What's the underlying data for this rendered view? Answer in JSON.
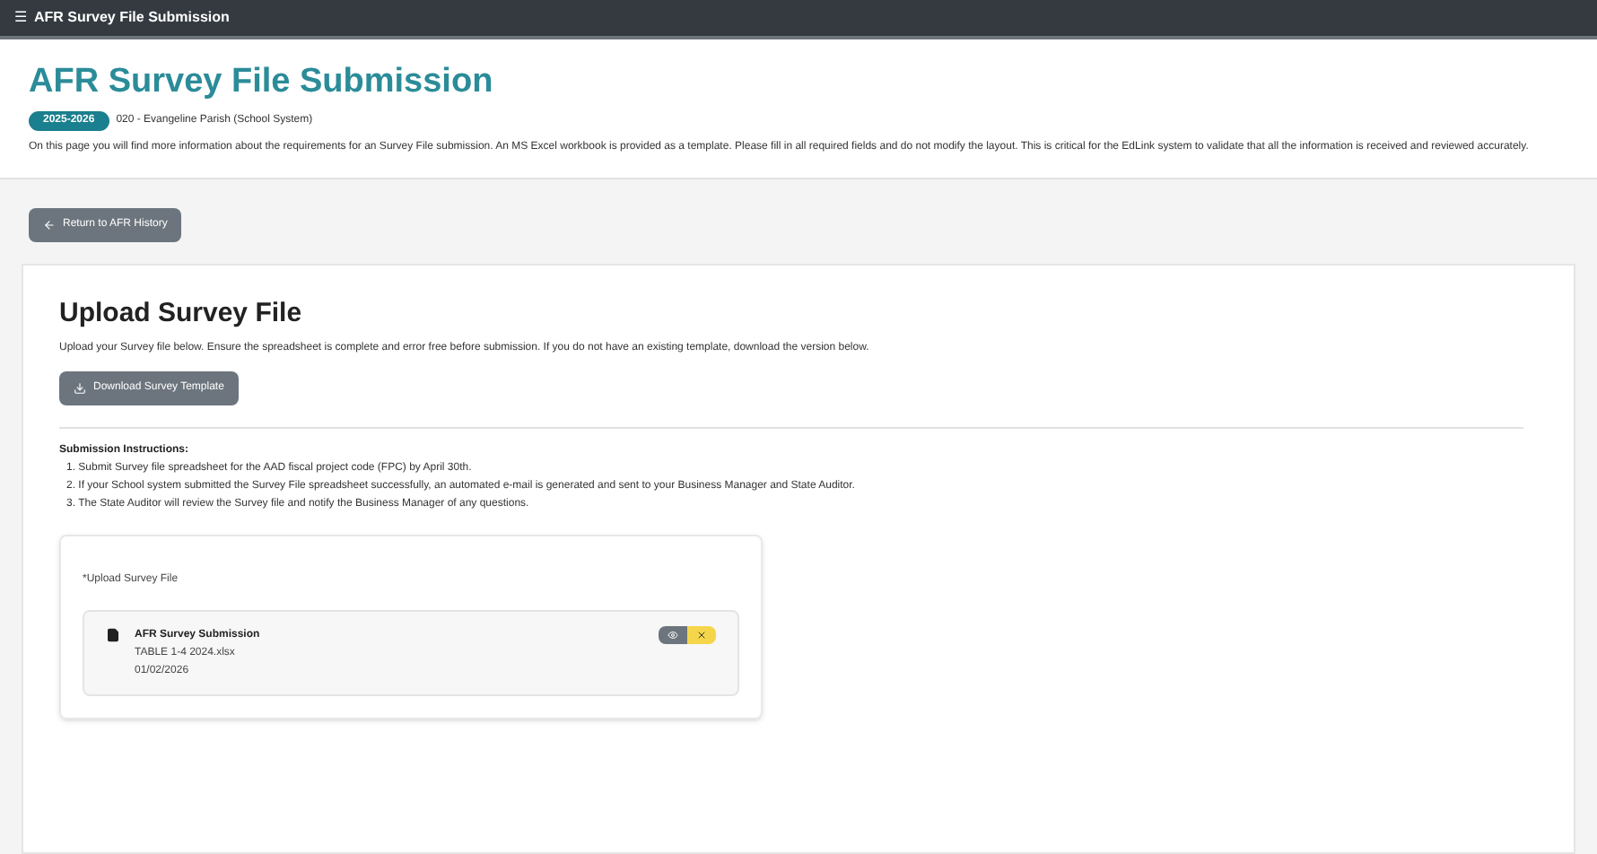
{
  "topbar": {
    "menu_glyph": "☰",
    "title": "AFR Survey File Submission"
  },
  "header": {
    "title": "AFR Survey File Submission",
    "badge": "2025-2026",
    "entity": "020 - Evangeline Parish (School System)",
    "description": "On this page you will find more information about the requirements for an Survey File submission. An MS Excel workbook is provided as a template. Please fill in all required fields and do not modify the layout. This is critical for the EdLink system to validate that all the information is received and reviewed accurately."
  },
  "back_button": {
    "label": "Return to AFR History"
  },
  "card": {
    "title": "Upload Survey File",
    "intro": "Upload your Survey file below. Ensure the spreadsheet is complete and error free before submission. If you do not have an existing template, download the version below.",
    "download_button": "Download Survey Template",
    "instructions_title": "Submission Instructions:",
    "instructions": [
      "1. Submit Survey file spreadsheet for the AAD fiscal project code (FPC) by April 30th.",
      "2. If your School system submitted the Survey File spreadsheet successfully, an automated e-mail is generated and sent to your Business Manager and State Auditor.",
      "3. The State Auditor will review the Survey file and notify the Business Manager of any questions."
    ],
    "upload": {
      "label": "*Upload Survey File",
      "file": {
        "name": "AFR Survey Submission",
        "filename": "TABLE 1-4 2024.xlsx",
        "date": "01/02/2026"
      }
    }
  }
}
